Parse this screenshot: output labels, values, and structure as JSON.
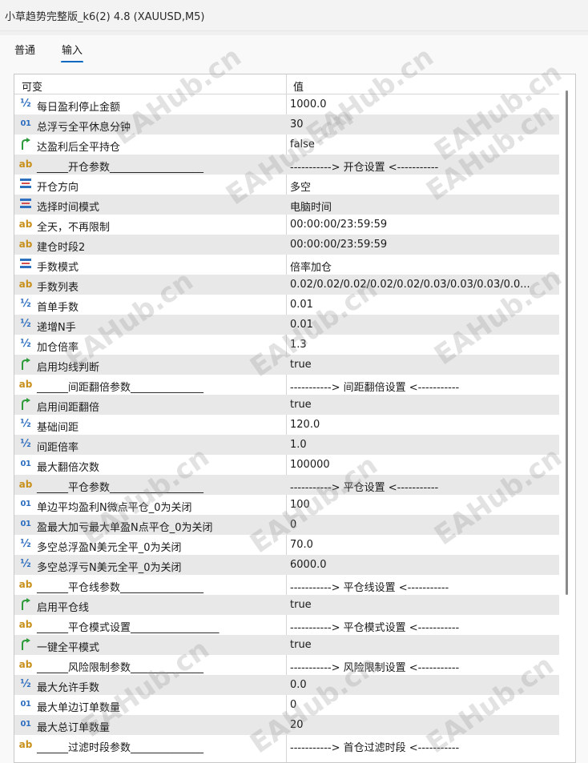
{
  "window": {
    "title": "小草趋势完整版_k6(2) 4.8 (XAUUSD,M5)"
  },
  "tabs": [
    {
      "label": "普通",
      "active": false
    },
    {
      "label": "输入",
      "active": true
    }
  ],
  "table": {
    "headers": {
      "variable": "可变",
      "value": "值"
    },
    "rows": [
      {
        "icon": "fraction-icon",
        "name": "每日盈利停止金额",
        "value": "1000.0"
      },
      {
        "icon": "integer-icon",
        "name": "总浮亏全平休息分钟",
        "value": "30"
      },
      {
        "icon": "boolean-icon",
        "name": "达盈利后全平持仓",
        "value": "false"
      },
      {
        "icon": "string-icon",
        "name": "______开仓参数__________________",
        "value": "-----------> 开仓设置 <-----------"
      },
      {
        "icon": "enum-icon",
        "name": "开仓方向",
        "value": "多空"
      },
      {
        "icon": "enum-icon",
        "name": "选择时间模式",
        "value": "电脑时间"
      },
      {
        "icon": "string-icon",
        "name": "全天，不再限制",
        "value": "00:00:00/23:59:59"
      },
      {
        "icon": "string-icon",
        "name": "建仓时段2",
        "value": "00:00:00/23:59:59"
      },
      {
        "icon": "enum-icon",
        "name": "手数模式",
        "value": "倍率加仓"
      },
      {
        "icon": "string-icon",
        "name": "手数列表",
        "value": "0.02/0.02/0.02/0.02/0.02/0.03/0.03/0.03/0.0..."
      },
      {
        "icon": "fraction-icon",
        "name": "首单手数",
        "value": "0.01"
      },
      {
        "icon": "fraction-icon",
        "name": "递增N手",
        "value": "0.01"
      },
      {
        "icon": "fraction-icon",
        "name": "加仓倍率",
        "value": "1.3"
      },
      {
        "icon": "boolean-icon",
        "name": "启用均线判断",
        "value": "true"
      },
      {
        "icon": "string-icon",
        "name": "______间距翻倍参数______________",
        "value": "-----------> 间距翻倍设置 <-----------"
      },
      {
        "icon": "boolean-icon",
        "name": "启用间距翻倍",
        "value": "true"
      },
      {
        "icon": "fraction-icon",
        "name": "基础间距",
        "value": "120.0"
      },
      {
        "icon": "fraction-icon",
        "name": "间距倍率",
        "value": "1.0"
      },
      {
        "icon": "integer-icon",
        "name": "最大翻倍次数",
        "value": "100000"
      },
      {
        "icon": "string-icon",
        "name": "______平仓参数__________________",
        "value": "-----------> 平仓设置 <-----------"
      },
      {
        "icon": "integer-icon",
        "name": "单边平均盈利N微点平仓_0为关闭",
        "value": "100"
      },
      {
        "icon": "integer-icon",
        "name": "盈最大加亏最大单盈N点平仓_0为关闭",
        "value": "0"
      },
      {
        "icon": "fraction-icon",
        "name": "多空总浮盈N美元全平_0为关闭",
        "value": "70.0"
      },
      {
        "icon": "fraction-icon",
        "name": "多空总浮亏N美元全平_0为关闭",
        "value": "6000.0"
      },
      {
        "icon": "string-icon",
        "name": "______平仓线参数________________",
        "value": "-----------> 平仓线设置 <-----------"
      },
      {
        "icon": "boolean-icon",
        "name": "启用平仓线",
        "value": "true"
      },
      {
        "icon": "string-icon",
        "name": "______平仓模式设置_________________",
        "value": "-----------> 平仓模式设置 <-----------"
      },
      {
        "icon": "boolean-icon",
        "name": "一键全平模式",
        "value": "true"
      },
      {
        "icon": "string-icon",
        "name": "______风险限制参数______________",
        "value": "-----------> 风险限制设置 <-----------"
      },
      {
        "icon": "fraction-icon",
        "name": "最大允许手数",
        "value": "0.0"
      },
      {
        "icon": "integer-icon",
        "name": "最大单边订单数量",
        "value": "0"
      },
      {
        "icon": "integer-icon",
        "name": "最大总订单数量",
        "value": "20"
      },
      {
        "icon": "string-icon",
        "name": "______过滤时段参数______________",
        "value": "-----------> 首仓过滤时段 <-----------"
      }
    ]
  },
  "watermark": {
    "text": "EAHub.cn"
  },
  "colors": {
    "accent": "#0067c0",
    "stripe": "#e8e8e8",
    "bool_icon": "#2e9b3a",
    "string_icon": "#c8901a",
    "number_icon": "#2f6fc0"
  }
}
